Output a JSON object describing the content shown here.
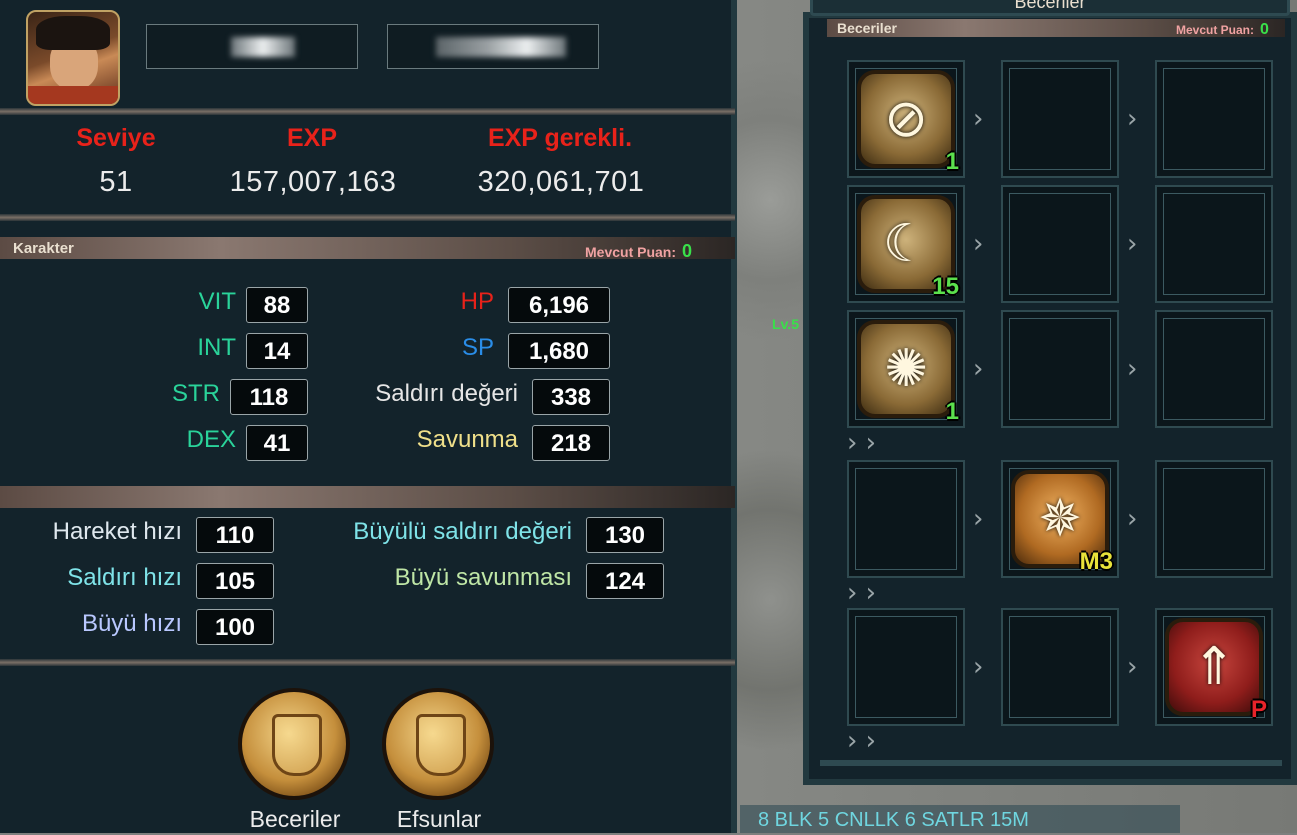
{
  "character": {
    "headers": {
      "level": "Seviye",
      "exp": "EXP",
      "exp_required": "EXP gerekli."
    },
    "values": {
      "level": "51",
      "exp": "157,007,163",
      "exp_required": "320,061,701"
    },
    "section_title": "Karakter",
    "points_label": "Mevcut Puan:",
    "points_value": "0",
    "stats": {
      "vit": {
        "label": "VIT",
        "value": "88"
      },
      "int": {
        "label": "INT",
        "value": "14"
      },
      "str": {
        "label": "STR",
        "value": "118"
      },
      "dex": {
        "label": "DEX",
        "value": "41"
      },
      "hp": {
        "label": "HP",
        "value": "6,196"
      },
      "sp": {
        "label": "SP",
        "value": "1,680"
      },
      "attack": {
        "label": "Saldırı değeri",
        "value": "338"
      },
      "defense": {
        "label": "Savunma",
        "value": "218"
      }
    },
    "secondary": {
      "move_speed": {
        "label": "Hareket hızı",
        "value": "110"
      },
      "attack_speed": {
        "label": "Saldırı hızı",
        "value": "105"
      },
      "cast_speed": {
        "label": "Büyü hızı",
        "value": "100"
      },
      "magic_attack": {
        "label": "Büyülü saldırı değeri",
        "value": "130"
      },
      "magic_defense": {
        "label": "Büyü savunması",
        "value": "124"
      }
    },
    "buttons": {
      "skills": "Beceriler",
      "enchants": "Efsunlar"
    }
  },
  "skills": {
    "window_title": "Beceriler",
    "section_title": "Beceriler",
    "points_label": "Mevcut Puan:",
    "points_value": "0",
    "slots": [
      {
        "icon": "sword-slash-icon",
        "level": "1",
        "level_color": "#5be04d"
      },
      {
        "icon": "crescent-orbs-icon",
        "level": "15",
        "level_color": "#5be04d"
      },
      {
        "icon": "spinning-blades-icon",
        "level": "1",
        "level_color": "#5be04d"
      },
      {
        "icon": "tree-burst-icon",
        "level": "M3",
        "level_color": "#e8e23a"
      },
      {
        "icon": "pine-leaf-icon",
        "level": "P",
        "level_color": "#e8232a"
      }
    ]
  },
  "world": {
    "nameplate": "Lv.5",
    "chat_text": "8 BLK 5 CNLLK 6 SATLR 15M"
  },
  "colors": {
    "header_red": "#e8221a",
    "vit_int_str_dex": "#2ad39a",
    "hp": "#e8221a",
    "sp": "#2a8de8",
    "attack": "#e6e6e6",
    "defense": "#f0e08a",
    "light_label": "#dfe8ee",
    "aqua_label": "#7fe3e8",
    "lavender_label": "#b9c8ff",
    "green_label": "#bfe6a6",
    "points_green": "#39e04a"
  }
}
